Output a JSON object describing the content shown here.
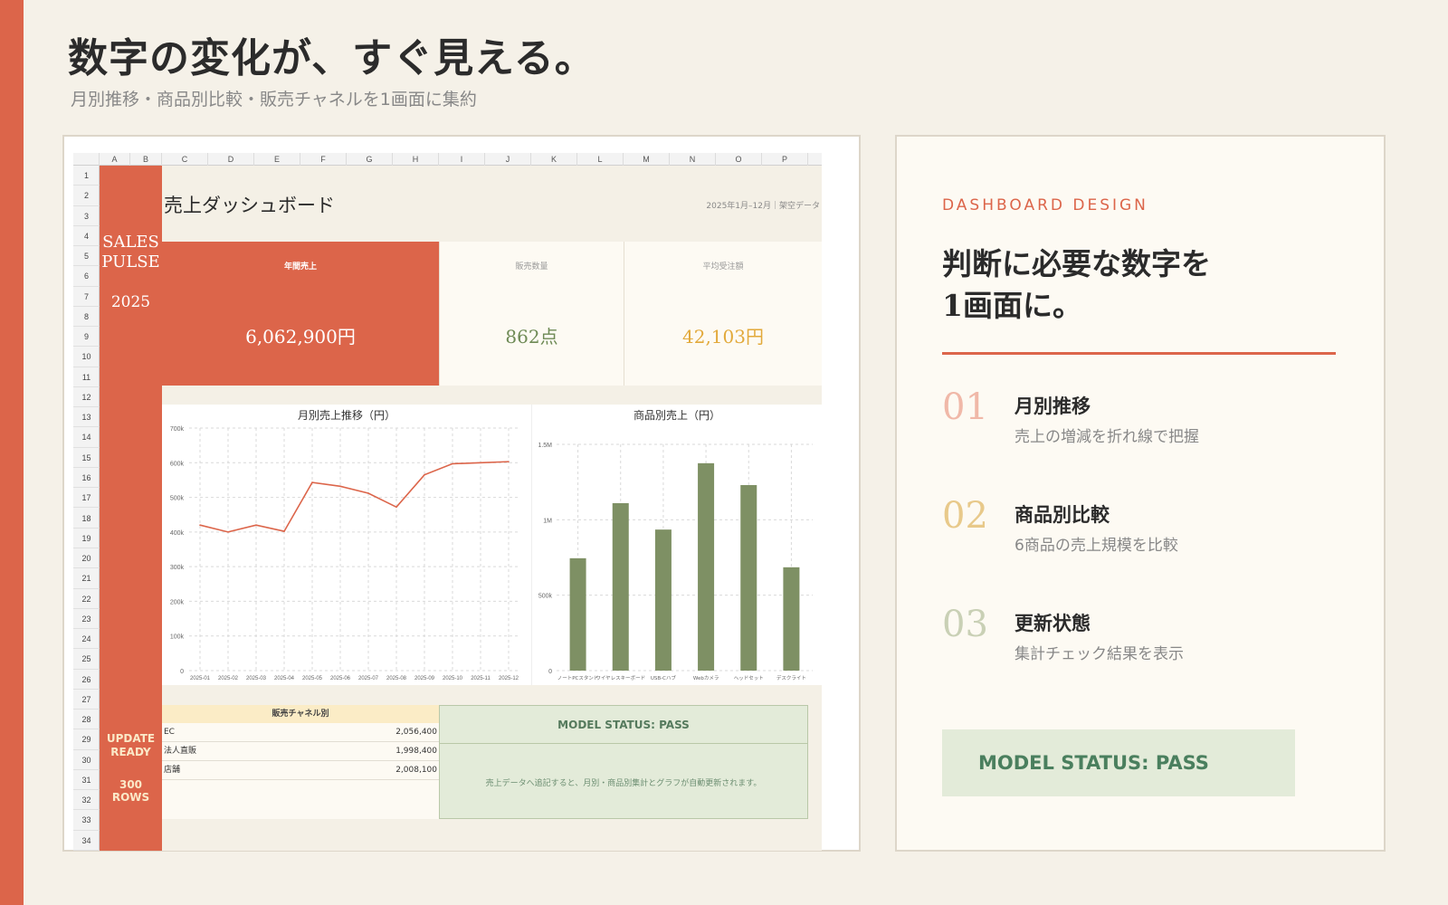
{
  "header": {
    "headline": "数字の変化が、すぐ見える。",
    "subline": "月別推移・商品別比較・販売チャネルを1画面に集約"
  },
  "sheet": {
    "columns": [
      "A",
      "B",
      "C",
      "D",
      "E",
      "F",
      "G",
      "H",
      "I",
      "J",
      "K",
      "L",
      "M",
      "N",
      "O",
      "P"
    ],
    "rows": [
      "1",
      "2",
      "3",
      "4",
      "5",
      "6",
      "7",
      "8",
      "9",
      "10",
      "11",
      "12",
      "13",
      "14",
      "15",
      "16",
      "17",
      "18",
      "19",
      "20",
      "21",
      "22",
      "23",
      "24",
      "25",
      "26",
      "27",
      "28",
      "29",
      "30",
      "31",
      "32",
      "33",
      "34"
    ],
    "side": {
      "brand_line1": "SALES",
      "brand_line2": "PULSE",
      "year": "2025",
      "update_line1": "UPDATE",
      "update_line2": "READY",
      "rows_count": "300 ROWS"
    },
    "title": "売上ダッシュボード",
    "period": "2025年1月–12月｜架空データ",
    "kpis": [
      {
        "label": "年間売上",
        "value": "6,062,900円"
      },
      {
        "label": "販売数量",
        "value": "862点"
      },
      {
        "label": "平均受注額",
        "value": "42,103円"
      }
    ],
    "channels": {
      "title": "販売チャネル別",
      "rows": [
        {
          "name": "EC",
          "value": "2,056,400"
        },
        {
          "name": "法人直販",
          "value": "1,998,400"
        },
        {
          "name": "店舗",
          "value": "2,008,100"
        }
      ]
    },
    "status": {
      "label": "MODEL STATUS: PASS",
      "note": "売上データへ追記すると、月別・商品別集計とグラフが自動更新されます。"
    }
  },
  "chart_data": [
    {
      "type": "line",
      "title": "月別売上推移（円）",
      "x": [
        "2025-01",
        "2025-02",
        "2025-03",
        "2025-04",
        "2025-05",
        "2025-06",
        "2025-07",
        "2025-08",
        "2025-09",
        "2025-10",
        "2025-11",
        "2025-12"
      ],
      "values": [
        420000,
        400000,
        420000,
        402000,
        543000,
        532000,
        512000,
        472000,
        565000,
        597000,
        600000,
        603000
      ],
      "ylim": [
        0,
        700000
      ],
      "yticks": [
        {
          "v": 0,
          "label": "0"
        },
        {
          "v": 100000,
          "label": "100k"
        },
        {
          "v": 200000,
          "label": "200k"
        },
        {
          "v": 300000,
          "label": "300k"
        },
        {
          "v": 400000,
          "label": "400k"
        },
        {
          "v": 500000,
          "label": "500k"
        },
        {
          "v": 600000,
          "label": "600k"
        },
        {
          "v": 700000,
          "label": "700k"
        }
      ],
      "grid": true,
      "color": "#dc654a"
    },
    {
      "type": "bar",
      "title": "商品別売上（円）",
      "categories": [
        "ノートPCスタンド",
        "ワイヤレスキーボード",
        "USB-Cハブ",
        "Webカメラ",
        "ヘッドセット",
        "デスクライト"
      ],
      "values": [
        745000,
        1110000,
        935000,
        1375000,
        1230000,
        685000
      ],
      "ylim": [
        0,
        1500000
      ],
      "yticks": [
        {
          "v": 0,
          "label": "0"
        },
        {
          "v": 500000,
          "label": "500k"
        },
        {
          "v": 1000000,
          "label": "1M"
        },
        {
          "v": 1500000,
          "label": "1.5M"
        }
      ],
      "grid": true,
      "color": "#7e9064"
    }
  ],
  "panel": {
    "eyebrow": "DASHBOARD DESIGN",
    "title_line1": "判断に必要な数字を",
    "title_line2": "1画面に。",
    "steps": [
      {
        "num": "01",
        "heading": "月別推移",
        "desc": "売上の増減を折れ線で把握"
      },
      {
        "num": "02",
        "heading": "商品別比較",
        "desc": "6商品の売上規模を比較"
      },
      {
        "num": "03",
        "heading": "更新状態",
        "desc": "集計チェック結果を表示"
      }
    ],
    "status": "MODEL STATUS: PASS"
  },
  "colors": {
    "accent": "#dc654a",
    "green": "#7e9064",
    "gold": "#e2a93a",
    "pass_bg": "#e3ebd9",
    "pass_text": "#4a7f5e"
  }
}
